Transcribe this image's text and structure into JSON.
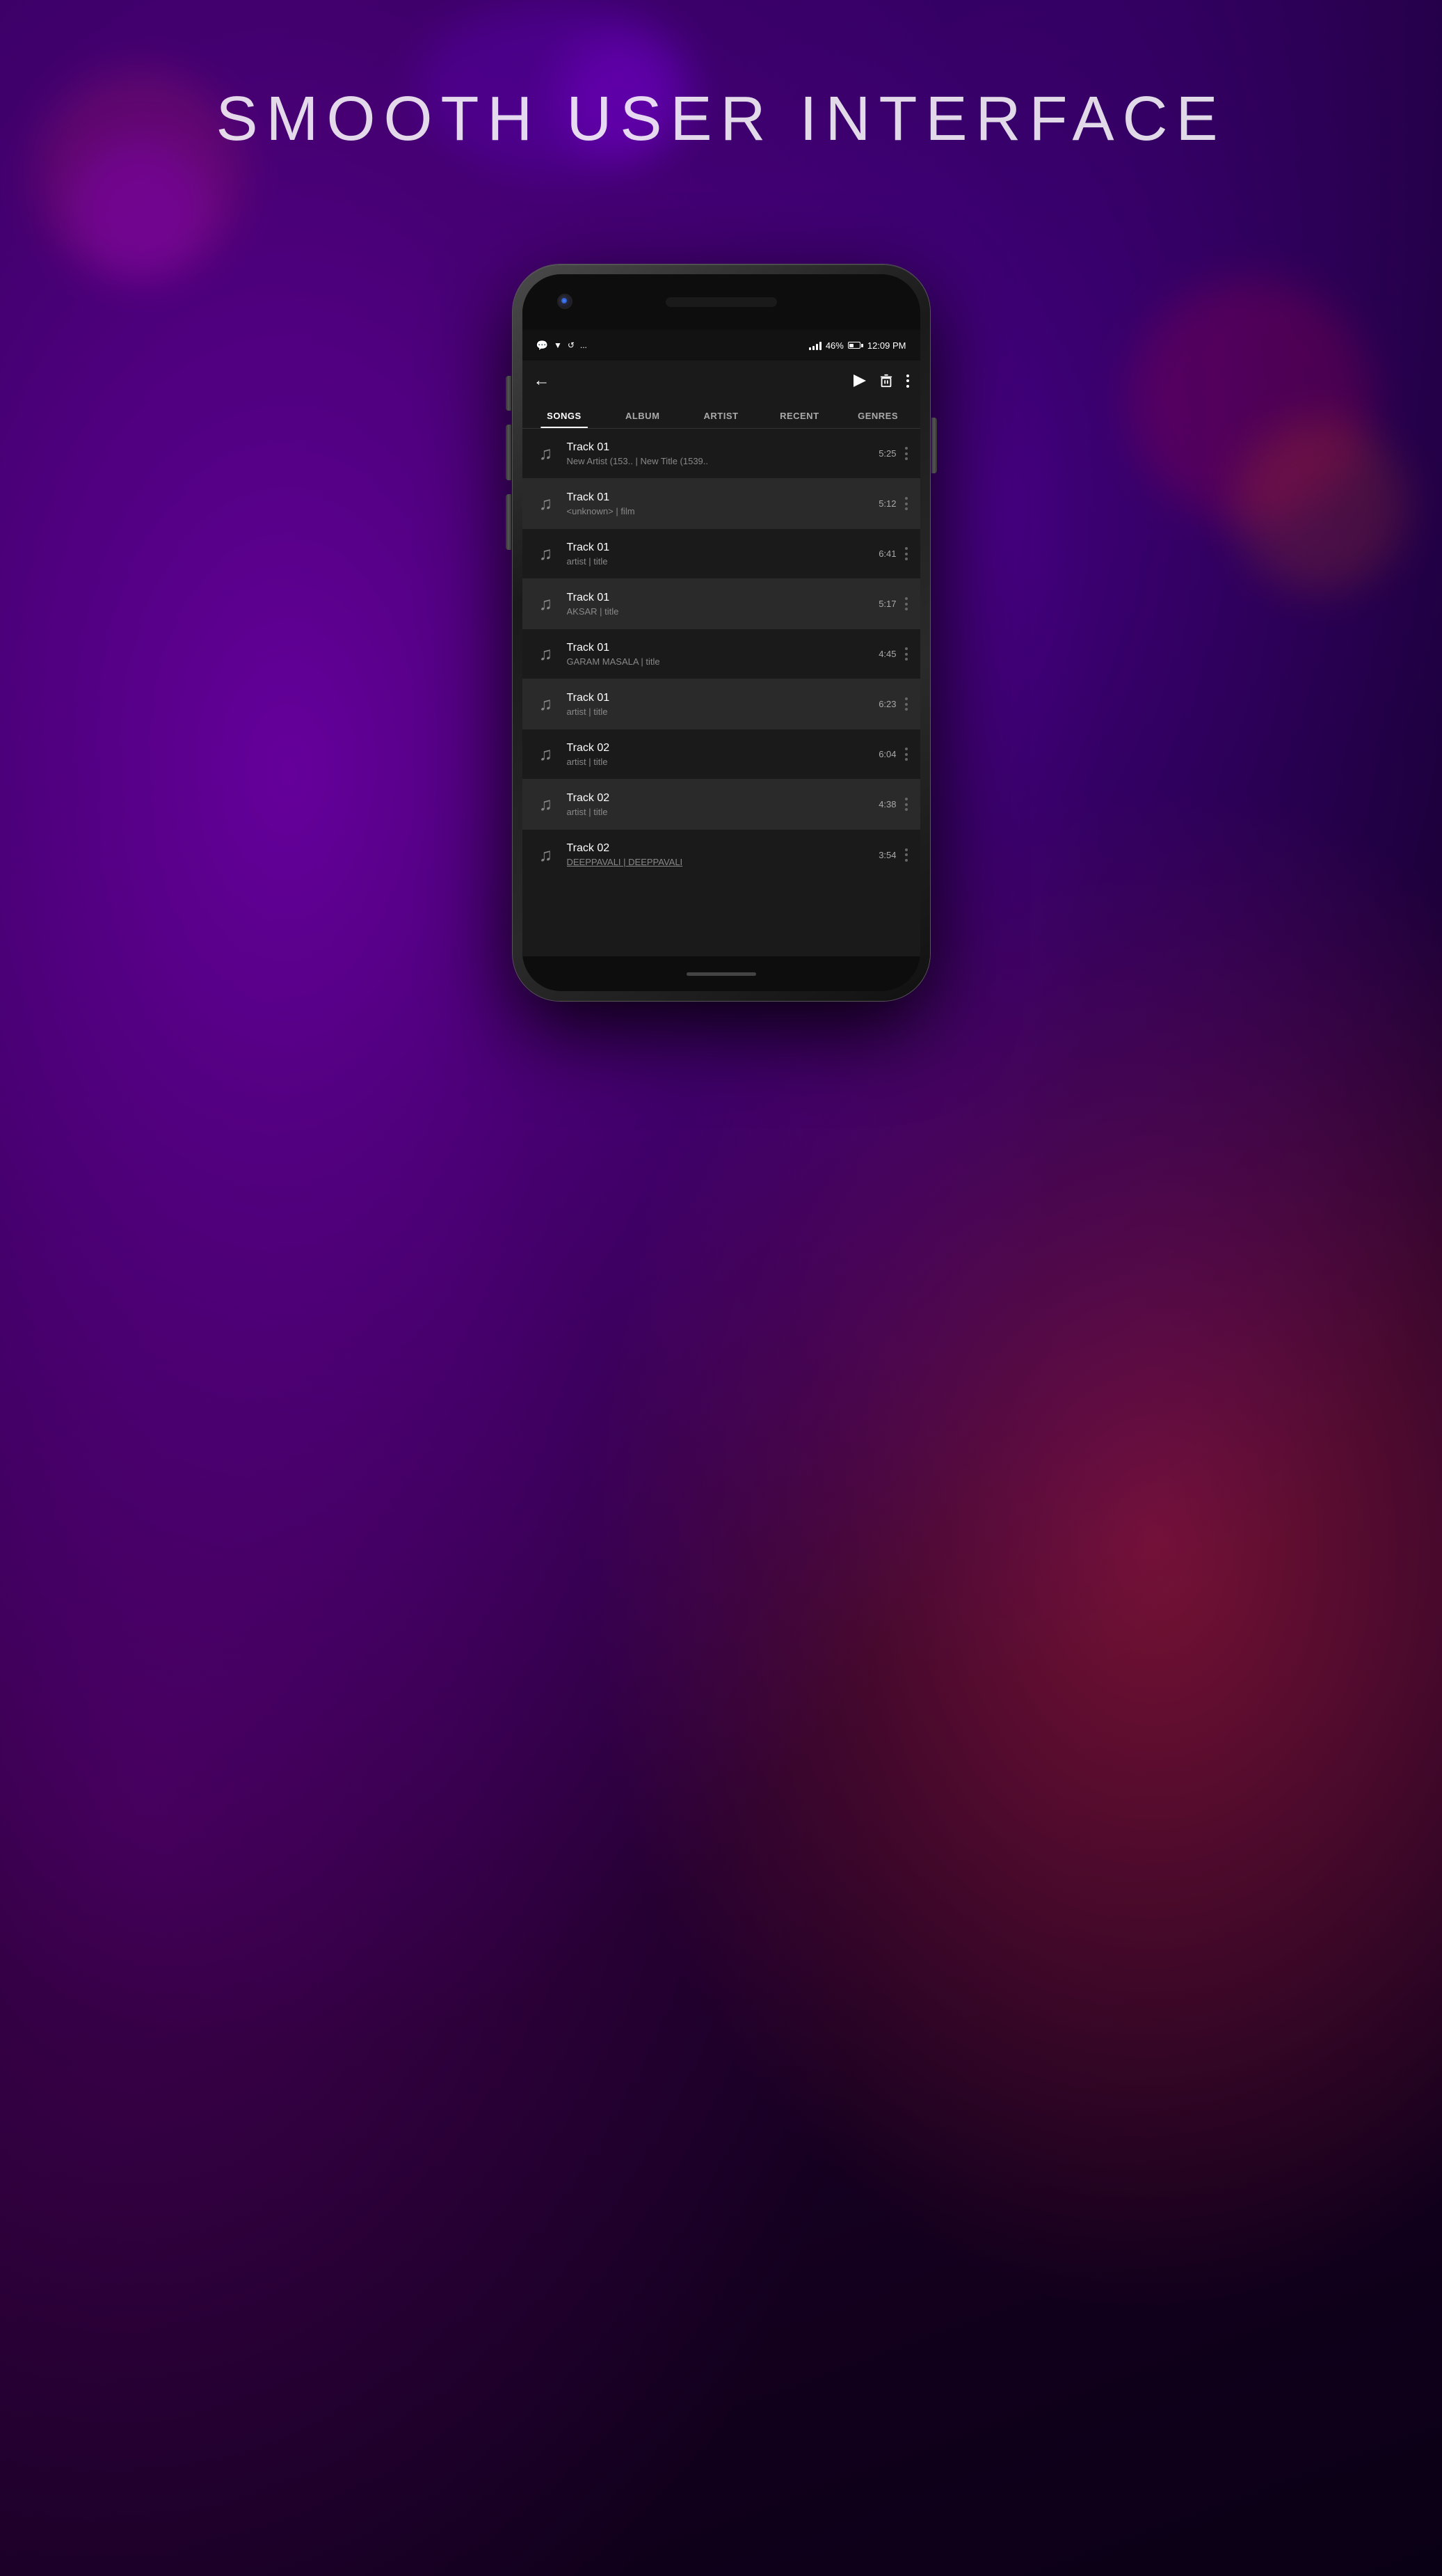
{
  "page": {
    "title": "SMOOTH USER INTERFACE"
  },
  "status_bar": {
    "signal": "signal",
    "battery_percent": "46%",
    "time": "12:09 PM",
    "icons": [
      "whatsapp",
      "download",
      "sync",
      "..."
    ]
  },
  "tabs": [
    {
      "label": "SONGS",
      "active": true
    },
    {
      "label": "ALBUM",
      "active": false
    },
    {
      "label": "ARTIST",
      "active": false
    },
    {
      "label": "RECENT",
      "active": false
    },
    {
      "label": "GENRES",
      "active": false
    }
  ],
  "songs": [
    {
      "title": "Track 01",
      "subtitle": "New Artist (153.. | New Title (1539..",
      "duration": "5:25",
      "highlighted": false
    },
    {
      "title": "Track 01",
      "subtitle": "<unknown> | film",
      "duration": "5:12",
      "highlighted": true
    },
    {
      "title": "Track 01",
      "subtitle": "artist | title",
      "duration": "6:41",
      "highlighted": false
    },
    {
      "title": "Track 01",
      "subtitle": "AKSAR | title",
      "duration": "5:17",
      "highlighted": true
    },
    {
      "title": "Track 01",
      "subtitle": "GARAM MASALA | title",
      "duration": "4:45",
      "highlighted": false
    },
    {
      "title": "Track 01",
      "subtitle": "artist | title",
      "duration": "6:23",
      "highlighted": true
    },
    {
      "title": "Track 02",
      "subtitle": "artist | title",
      "duration": "6:04",
      "highlighted": false
    },
    {
      "title": "Track 02",
      "subtitle": "artist | title",
      "duration": "4:38",
      "highlighted": true
    },
    {
      "title": "Track 02",
      "subtitle": "DEEPPAVALI | DEEPPAVALI",
      "duration": "3:54",
      "highlighted": false
    }
  ]
}
